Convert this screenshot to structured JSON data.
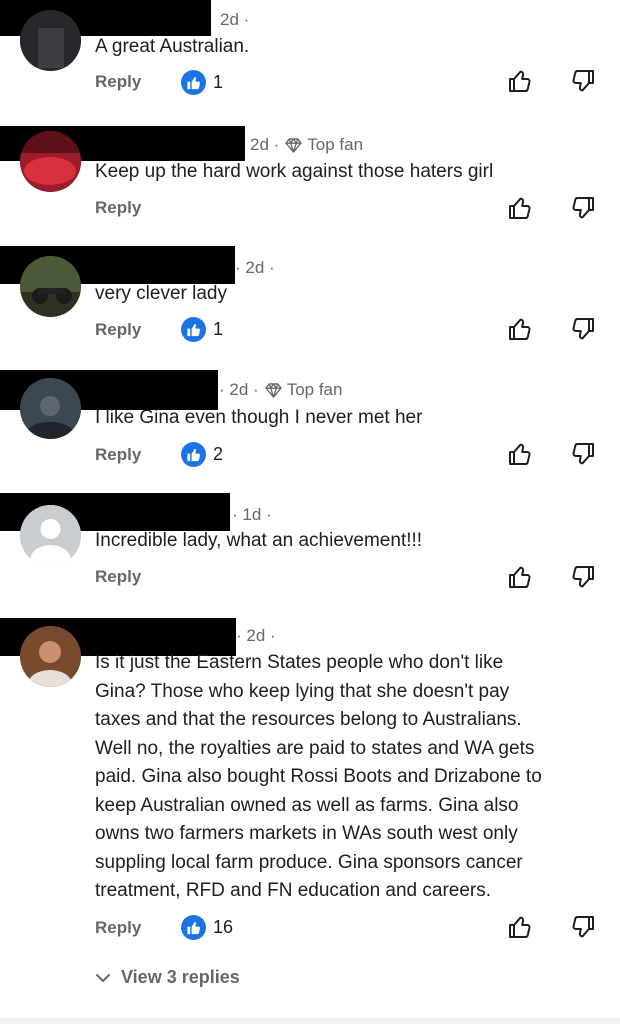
{
  "comments": [
    {
      "time": "2d ·",
      "badge": "",
      "lines": [
        "A great Australian."
      ],
      "reply_label": "Reply",
      "reactions": "1"
    },
    {
      "time": "2d ·",
      "badge": "Top fan",
      "lines": [
        "Keep up the hard work against those haters girl"
      ],
      "reply_label": "Reply",
      "reactions": ""
    },
    {
      "time": "· 2d ·",
      "badge": "",
      "lines": [
        "very clever lady"
      ],
      "reply_label": "Reply",
      "reactions": "1"
    },
    {
      "time": "· 2d ·",
      "badge": "Top fan",
      "lines": [
        "I like Gina even  though  I never  met her"
      ],
      "reply_label": "Reply",
      "reactions": "2"
    },
    {
      "time": "· 1d ·",
      "badge": "",
      "lines": [
        "Incredible lady, what an achievement!!!"
      ],
      "reply_label": "Reply",
      "reactions": ""
    },
    {
      "time": "· 2d ·",
      "badge": "",
      "lines": [
        "Is it just the Eastern States people who don't like",
        "Gina? Those who keep lying that she doesn't pay",
        "taxes and that the resources belong to Australians.",
        "Well no, the royalties are paid to states and WA gets",
        "paid. Gina also bought Rossi Boots and Drizabone to",
        "keep Australian owned as well as farms. Gina also",
        "owns two farmers markets in WAs south west only",
        "suppling local farm produce. Gina sponsors cancer",
        "treatment, RFD and FN education and careers."
      ],
      "reply_label": "Reply",
      "reactions": "16"
    }
  ],
  "view_replies": "View 3 replies",
  "icons": {
    "reaction": "like-reaction-icon",
    "upvote": "thumbs-up-outline-icon",
    "downvote": "thumbs-down-outline-icon",
    "badge": "diamond-icon",
    "expand": "chevron-down-icon"
  },
  "colors": {
    "like_blue": "#1b74e4",
    "muted_text": "#65676b"
  }
}
